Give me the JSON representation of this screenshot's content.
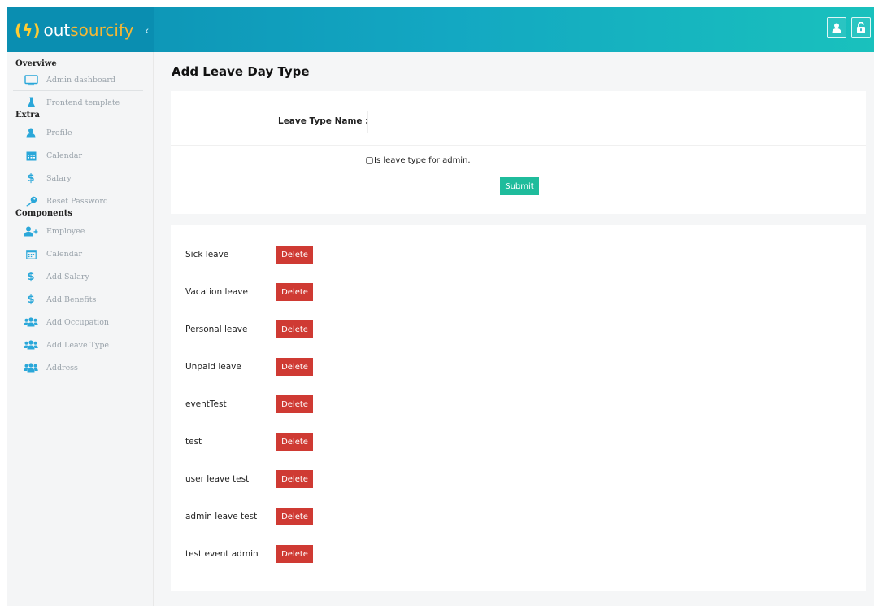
{
  "brand": {
    "prefix": "(",
    "bolt": "ϟ",
    "suffix": ")",
    "name_part1": "out",
    "name_part2": "sourcify",
    "collapse": "‹"
  },
  "header": {
    "user_icon": "user-icon",
    "lock_icon": "unlock-icon"
  },
  "sidebar": {
    "sections": [
      {
        "title": "Overviwe",
        "items": [
          {
            "label": "Admin dashboard",
            "icon": "monitor-icon"
          },
          {
            "label": "Frontend template",
            "icon": "flask-icon"
          }
        ]
      },
      {
        "title": "Extra",
        "items": [
          {
            "label": "Profile",
            "icon": "user-icon"
          },
          {
            "label": "Calendar",
            "icon": "calendar-icon"
          },
          {
            "label": "Salary",
            "icon": "dollar-icon"
          },
          {
            "label": "Reset Password",
            "icon": "key-icon"
          }
        ]
      },
      {
        "title": "Components",
        "items": [
          {
            "label": "Employee",
            "icon": "user-plus-icon"
          },
          {
            "label": "Calendar",
            "icon": "calendar-outline-icon"
          },
          {
            "label": "Add Salary",
            "icon": "dollar-icon"
          },
          {
            "label": "Add Benefits",
            "icon": "dollar-icon"
          },
          {
            "label": "Add Occupation",
            "icon": "users-icon"
          },
          {
            "label": "Add Leave Type",
            "icon": "users-icon"
          },
          {
            "label": "Address",
            "icon": "users-icon"
          }
        ]
      }
    ]
  },
  "page": {
    "title": "Add Leave Day Type"
  },
  "form": {
    "leave_type_label": "Leave Type Name :",
    "leave_type_value": "",
    "leave_type_placeholder": "",
    "admin_checkbox_label": "Is leave type for admin.",
    "admin_checked": false,
    "submit_label": "Submit"
  },
  "leave_types": [
    {
      "name": "Sick leave",
      "delete_label": "Delete"
    },
    {
      "name": "Vacation leave",
      "delete_label": "Delete"
    },
    {
      "name": "Personal leave",
      "delete_label": "Delete"
    },
    {
      "name": "Unpaid leave",
      "delete_label": "Delete"
    },
    {
      "name": "eventTest",
      "delete_label": "Delete"
    },
    {
      "name": "test",
      "delete_label": "Delete"
    },
    {
      "name": "user leave test",
      "delete_label": "Delete"
    },
    {
      "name": "admin leave test",
      "delete_label": "Delete"
    },
    {
      "name": "test event admin",
      "delete_label": "Delete"
    }
  ],
  "colors": {
    "header_start": "#0b8fb2",
    "header_end": "#19c1bd",
    "accent_icon": "#2aa7d9",
    "submit": "#1fbc9c",
    "delete": "#cf3a33"
  }
}
